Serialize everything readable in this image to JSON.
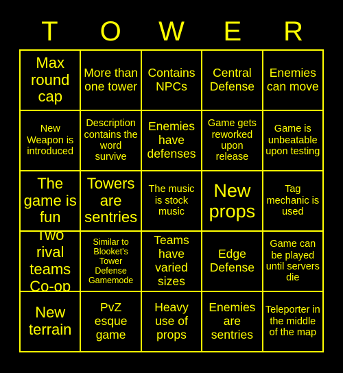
{
  "card": {
    "title": "TOWER",
    "title_letters": [
      "T",
      "O",
      "W",
      "E",
      "R"
    ],
    "colors": {
      "background": "#000000",
      "text": "#ffff00",
      "border": "#ffff00"
    },
    "grid_size": "5x5",
    "cells": [
      {
        "text": "Max round cap",
        "size": "lg"
      },
      {
        "text": "More than one tower",
        "size": "md"
      },
      {
        "text": "Contains NPCs",
        "size": "md"
      },
      {
        "text": "Central Defense",
        "size": "md"
      },
      {
        "text": "Enemies can move",
        "size": "md"
      },
      {
        "text": "New Weapon is introduced",
        "size": "sm"
      },
      {
        "text": "Description contains the word survive",
        "size": "sm"
      },
      {
        "text": "Enemies have defenses",
        "size": "md"
      },
      {
        "text": "Game gets reworked upon release",
        "size": "sm"
      },
      {
        "text": "Game is unbeatable upon testing",
        "size": "sm"
      },
      {
        "text": "The game is fun",
        "size": "lg"
      },
      {
        "text": "Towers are sentries",
        "size": "lg"
      },
      {
        "text": "The music is stock music",
        "size": "sm"
      },
      {
        "text": "New props",
        "size": "xl"
      },
      {
        "text": "Tag mechanic is used",
        "size": "sm"
      },
      {
        "text": "Two rival teams Co-op",
        "size": "lg"
      },
      {
        "text": "Similar to Blooket's Tower Defense Gamemode",
        "size": "xs"
      },
      {
        "text": "Teams have varied sizes",
        "size": "md"
      },
      {
        "text": "Edge Defense",
        "size": "md"
      },
      {
        "text": "Game can be played until servers die",
        "size": "sm"
      },
      {
        "text": "New terrain",
        "size": "lg"
      },
      {
        "text": "PvZ esque game",
        "size": "md"
      },
      {
        "text": "Heavy use of props",
        "size": "md"
      },
      {
        "text": "Enemies are sentries",
        "size": "md"
      },
      {
        "text": "Teleporter in the middle of the map",
        "size": "sm"
      }
    ]
  }
}
